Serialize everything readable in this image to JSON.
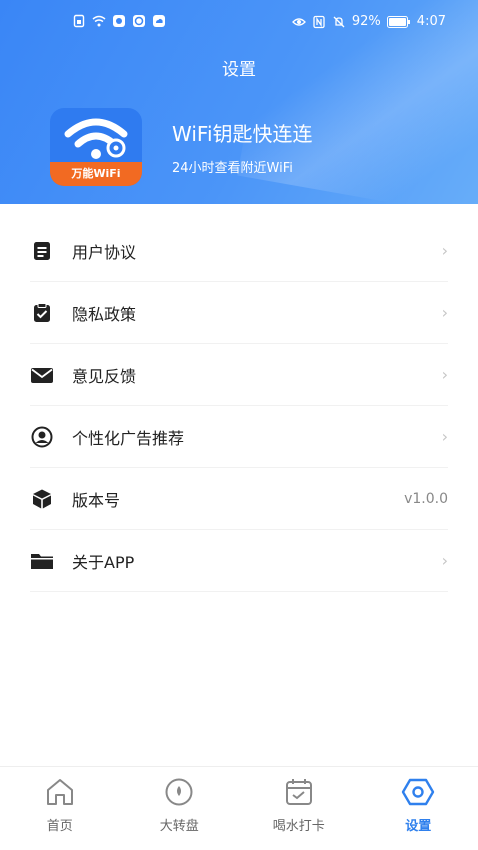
{
  "status_bar": {
    "battery": "92%",
    "time": "4:07"
  },
  "header": {
    "title": "设置",
    "app_logo_text": "万能WiFi",
    "app_name": "WiFi钥匙快连连",
    "app_subtitle": "24小时查看附近WiFi"
  },
  "menu": {
    "items": [
      {
        "label": "用户协议",
        "icon": "document-icon"
      },
      {
        "label": "隐私政策",
        "icon": "clipboard-check-icon"
      },
      {
        "label": "意见反馈",
        "icon": "envelope-icon"
      },
      {
        "label": "个性化广告推荐",
        "icon": "user-circle-icon"
      },
      {
        "label": "版本号",
        "icon": "cube-icon",
        "value": "v1.0.0"
      },
      {
        "label": "关于APP",
        "icon": "folder-icon"
      }
    ]
  },
  "tabbar": {
    "tabs": [
      {
        "label": "首页",
        "icon": "home-icon"
      },
      {
        "label": "大转盘",
        "icon": "wheel-icon"
      },
      {
        "label": "喝水打卡",
        "icon": "calendar-icon"
      },
      {
        "label": "设置",
        "icon": "settings-hexagon-icon",
        "active": true
      }
    ]
  },
  "colors": {
    "header_gradient_start": "#3a86f6",
    "header_gradient_end": "#67adf9",
    "active_tab": "#2f80ed",
    "logo_band": "#f26a22"
  }
}
